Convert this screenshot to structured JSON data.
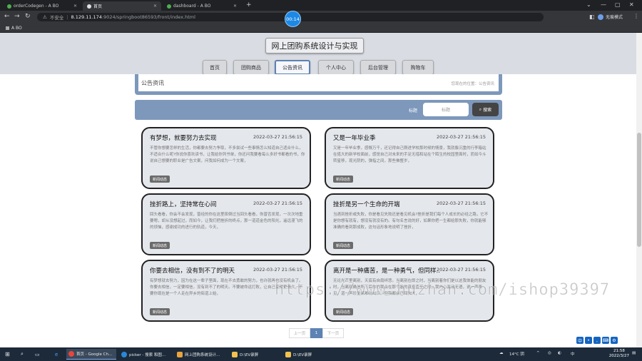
{
  "browser": {
    "tabs": [
      {
        "label": "orderCodegen - A BO",
        "active": false
      },
      {
        "label": "首页",
        "active": true
      },
      {
        "label": "dashboard - A BO",
        "active": false
      }
    ],
    "insecure_label": "不安全",
    "url_host": "8.129.11.174",
    "url_path": ":9024/springboot86593/front/index.html",
    "profile_label": "无痕模式",
    "bookmark": "A BO",
    "timer": "00:14"
  },
  "site": {
    "title": "网上团购系统设计与实现",
    "nav": [
      "首页",
      "团购商品",
      "公告资讯",
      "个人中心",
      "后台管理",
      "购物车"
    ],
    "active_nav": 2
  },
  "crumb": {
    "title": "公告资讯",
    "location": "您现在的位置：公告资讯"
  },
  "search": {
    "label": "标题",
    "placeholder": "标题",
    "button": "搜索"
  },
  "cards": [
    {
      "title": "有梦想，就要努力去实现",
      "date": "2022-03-27 21:56:15",
      "body": "不管你想要怎样的生活，你都要去努力争取，不多尝试一些事情怎么知道自己适合什么，不适合什么呢?你说你喜欢读书，让我给你列书单，你还问我要看每么多好书都看的书，你说自己想要的职业是广告文案，问我如何成为一个文案，",
      "tag": "新闻动态"
    },
    {
      "title": "又是一年毕业季",
      "date": "2022-03-27 21:56:15",
      "body": "又是一年毕业季，感慨万千，还记得自己刚进学校那时候的情景，我就像沉重的行李箱站在偌大的新学校面前，感觉自己对未来的手足无措和站在个陌生的校园里面时，而如今斗转星移，现光阴的，弹指之间，那些佛整岁，",
      "tag": "新闻动态"
    },
    {
      "title": "挫折路上，坚持常在心间",
      "date": "2022-03-27 21:56:15",
      "body": "回头看看，你会不会发现，曾经的你在这里摔倒过当回头看看，你曾否发现，一次次地重要嗯，却从没想起过，而如今，让我们把挫折的终点，那一道道金色的阳光，遥远漫飞的的烦恼，感谢成功的进行的轨道，今天，",
      "tag": "新闻动态"
    },
    {
      "title": "挫折是另一个生命的开端",
      "date": "2022-03-27 21:56:15",
      "body": "当遇到挫折或失败，你是看见失败还是看见机会?挫折是我们每个人成长的必经之路，它不是你想有就有，想没有就没有的。有句名言说的好，如果你把一生都给那失败，你就能够准确的看到那成败，这句话形象地说明了挫折，",
      "tag": "新闻动态"
    },
    {
      "title": "你要去相信，没有到不了的明天",
      "date": "2022-03-27 21:56:15",
      "body": "有梦想就去努力，因为在这一辈子里面，现在不去勇敢的努力，也许就再也没有机会了。你要去相信，一定要相信，没有到不了的明天。不要被命运打败，让自己变得更强大，不要你现在是一个人走在异乡的街道上始，",
      "tag": "新闻动态"
    },
    {
      "title": "离开是一种痛苦，是一种勇气，但同样...",
      "date": "2022-03-27 21:56:15",
      "body": "无论光芒里离别，天底有自扇绊悲。当离别在即之时，当离别着你们是以这我体能的朋友时，当离别确信所下后你的我会在那个能的真垂直至之时，我内心激动无语，说一声再见，道一声珍重都难说出口。但我都会已回你大，",
      "tag": "新闻动态"
    }
  ],
  "pager": {
    "prev": "上一页",
    "current": "1",
    "next": "下一页"
  },
  "watermark": "https://www.huzhan.com/ishop39397",
  "taskbar": {
    "items": [
      "首页 - Google Ch...",
      "picker - 搜索 和图...",
      "网上团购系统设计...",
      "D:\\EV录屏",
      "D:\\EV录屏"
    ],
    "weather": "14°C 阴",
    "ime": "中",
    "time": "21:58",
    "date": "2022/3/27"
  }
}
